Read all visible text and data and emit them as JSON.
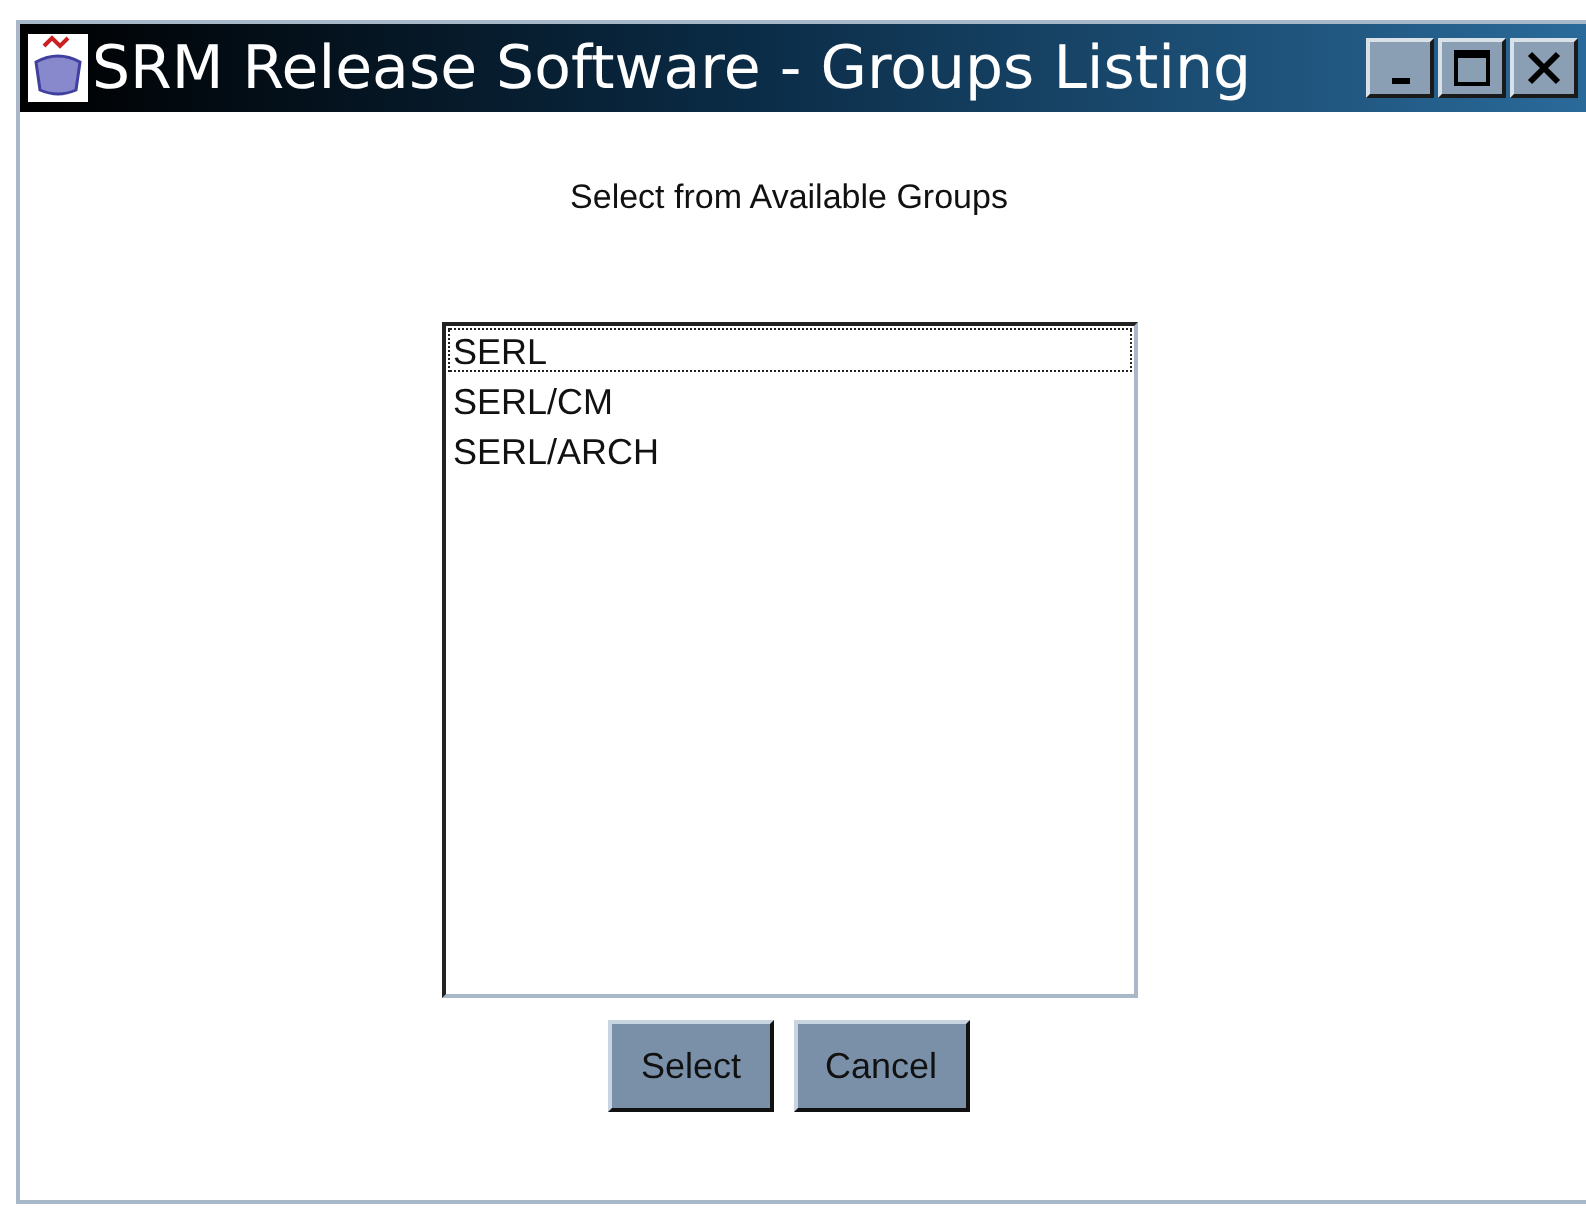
{
  "window": {
    "title": "SRM Release Software - Groups Listing"
  },
  "prompt": "Select from Available Groups",
  "groups": [
    {
      "name": "SERL",
      "focused": true
    },
    {
      "name": "SERL/CM",
      "focused": false
    },
    {
      "name": "SERL/ARCH",
      "focused": false
    }
  ],
  "buttons": [
    "Select",
    "Cancel"
  ]
}
